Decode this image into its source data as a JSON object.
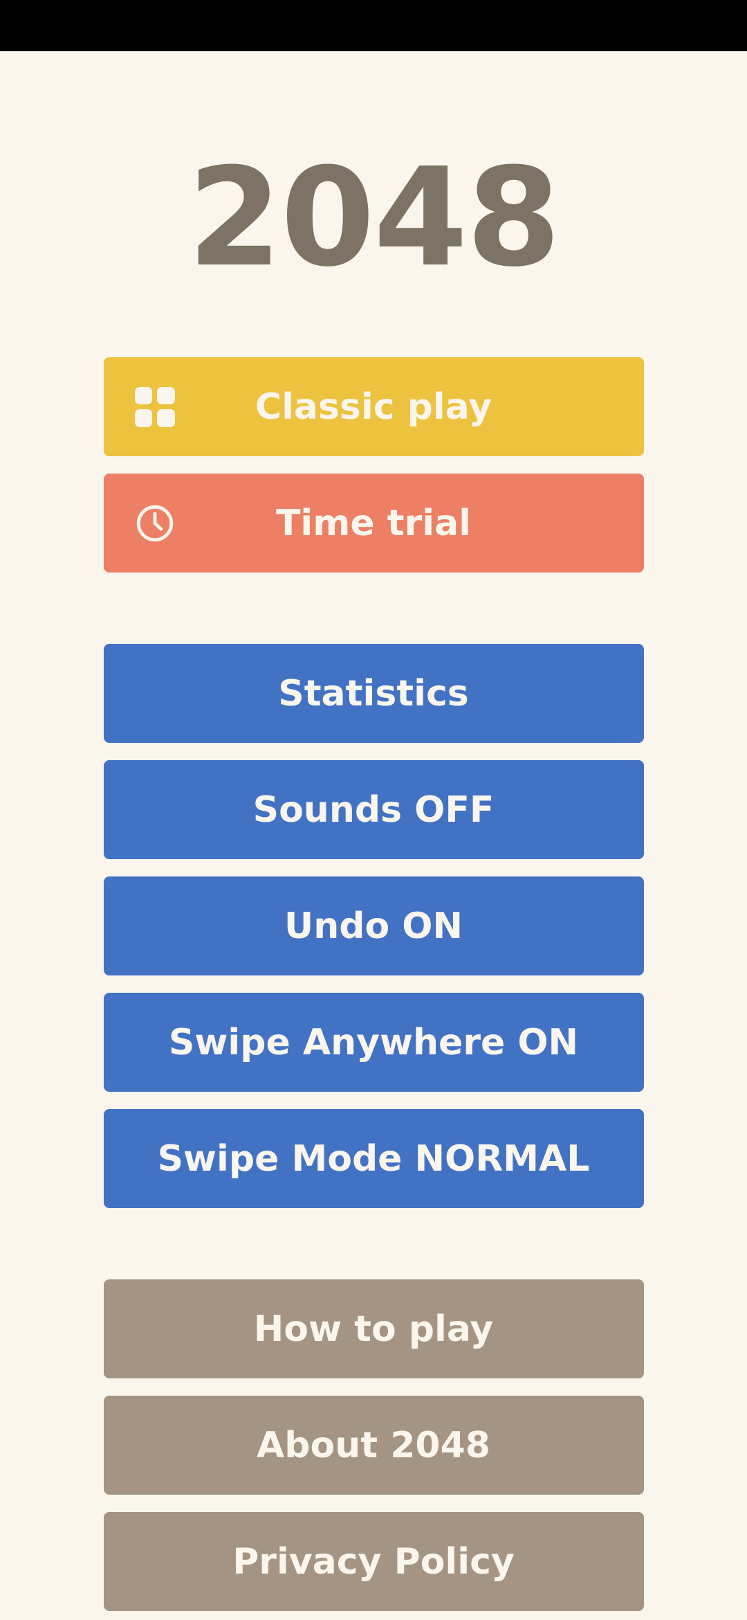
{
  "app": {
    "title": "2048",
    "background_color": "#FAF6ED",
    "title_color": "#7C7265",
    "status_bar_color": "#000000"
  },
  "play_buttons": [
    {
      "label": "Classic play",
      "icon": "grid-2x2-icon",
      "color": "#ECC23F",
      "text_color": "#FAF6ED"
    },
    {
      "label": "Time trial",
      "icon": "clock-icon",
      "color": "#ED7F64",
      "text_color": "#FAF6ED"
    }
  ],
  "settings_buttons": [
    {
      "label": "Statistics",
      "color": "#4272C4"
    },
    {
      "label": "Sounds OFF",
      "color": "#4272C4"
    },
    {
      "label": "Undo ON",
      "color": "#4272C4"
    },
    {
      "label": "Swipe Anywhere ON",
      "color": "#4272C4"
    },
    {
      "label": "Swipe Mode NORMAL",
      "color": "#4272C4"
    }
  ],
  "info_buttons": [
    {
      "label": "How to play",
      "color": "#A39483"
    },
    {
      "label": "About 2048",
      "color": "#A39483"
    },
    {
      "label": "Privacy Policy",
      "color": "#A39483"
    }
  ]
}
